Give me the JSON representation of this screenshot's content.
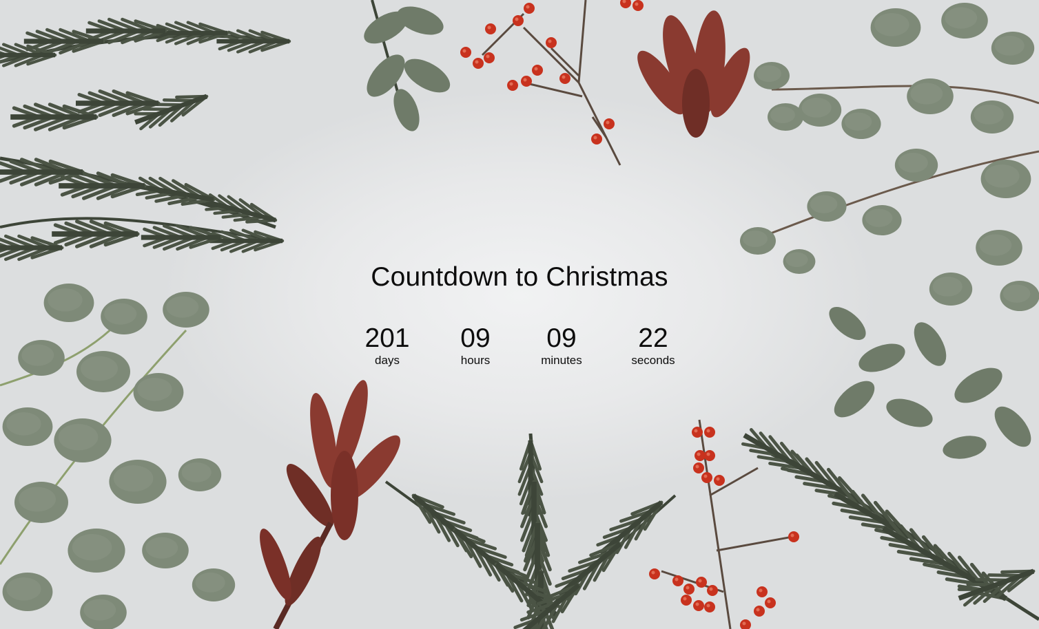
{
  "title": "Countdown to Christmas",
  "countdown": [
    {
      "value": "201",
      "label": "days"
    },
    {
      "value": "09",
      "label": "hours"
    },
    {
      "value": "09",
      "label": "minutes"
    },
    {
      "value": "22",
      "label": "seconds"
    }
  ],
  "colors": {
    "text": "#0d0d0d",
    "background": "#e9eaeb",
    "pine": "#4b5445",
    "eucalyptus": "#7e8a78",
    "berry": "#c8321e",
    "protea": "#8a3a30"
  }
}
